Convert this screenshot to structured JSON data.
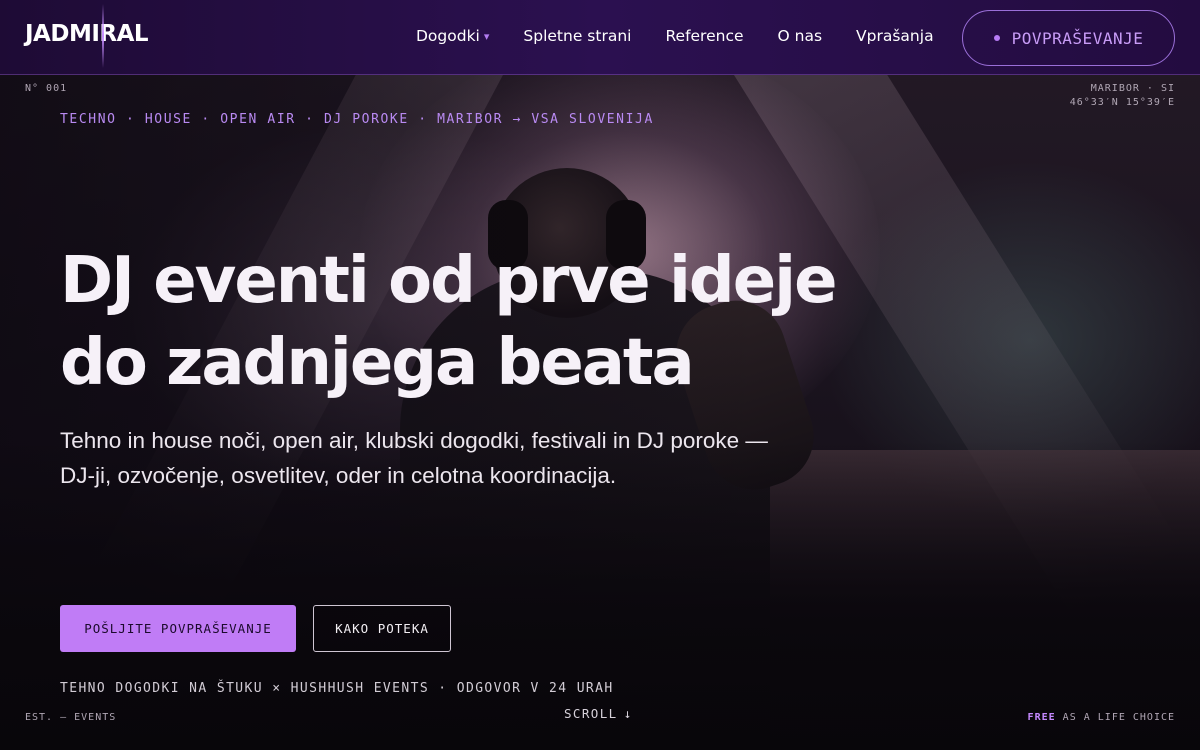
{
  "header": {
    "logo": "JADMIRAL",
    "nav": [
      {
        "label": "Dogodki",
        "caret": "▾"
      },
      {
        "label": "Spletne strani"
      },
      {
        "label": "Reference"
      },
      {
        "label": "O nas"
      },
      {
        "label": "Vprašanja"
      }
    ],
    "cta_label": "POVPRAŠEVANJE"
  },
  "hero": {
    "edition": "N° 001",
    "location_line1": "MARIBOR · SI",
    "location_line2": "46°33′N 15°39′E",
    "tagline": "TECHNO · HOUSE · OPEN AIR · DJ POROKE · MARIBOR → VSA SLOVENIJA",
    "headline_line1": "DJ eventi od prve ideje",
    "headline_line2": "do zadnjega beata",
    "subtext": "Tehno in house noči, open air, klubski dogodki, festivali in DJ poroke — DJ-ji, ozvočenje, osvetlitev, oder in celotna koordinacija.",
    "primary_button": "POŠLJITE POVPRAŠEVANJE",
    "secondary_button": "KAKO POTEKA",
    "partners": "TEHNO DOGODKI NA ŠTUKU × HUSHHUSH EVENTS · ODGOVOR V 24 URAH"
  },
  "footer_strip": {
    "est": "EST. — EVENTS",
    "scroll_label": "SCROLL",
    "scroll_arrow": "↓",
    "free_word": "FREE",
    "free_rest": "AS A LIFE CHOICE"
  },
  "colors": {
    "accent": "#c07cf6",
    "nav_background": "#2b1050",
    "tagline": "#b98af2"
  }
}
